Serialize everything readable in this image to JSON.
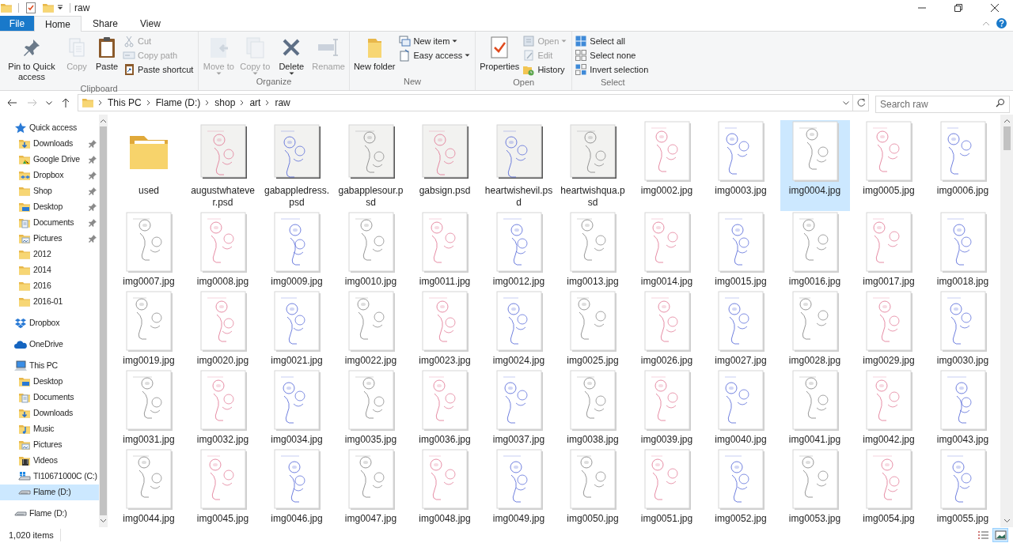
{
  "window": {
    "title": "raw"
  },
  "ribbon_tabs": [
    {
      "label": "File",
      "kind": "file",
      "selected": false
    },
    {
      "label": "Home",
      "kind": "tab",
      "selected": true
    },
    {
      "label": "Share",
      "kind": "tab",
      "selected": false
    },
    {
      "label": "View",
      "kind": "tab",
      "selected": false
    }
  ],
  "ribbon_groups": [
    {
      "label": "Clipboard",
      "items": [
        {
          "kind": "large",
          "label": "Pin to Quick access",
          "disabled": false
        },
        {
          "kind": "large",
          "label": "Copy",
          "disabled": true
        },
        {
          "kind": "large",
          "label": "Paste",
          "disabled": false
        },
        {
          "kind": "stack",
          "items": [
            {
              "label": "Cut",
              "disabled": true
            },
            {
              "label": "Copy path",
              "disabled": true
            },
            {
              "label": "Paste shortcut",
              "disabled": false
            }
          ]
        }
      ]
    },
    {
      "label": "Organize",
      "items": [
        {
          "kind": "large",
          "label": "Move to",
          "disabled": true,
          "dropdown": true
        },
        {
          "kind": "large",
          "label": "Copy to",
          "disabled": true,
          "dropdown": true
        },
        {
          "kind": "large",
          "label": "Delete",
          "disabled": false,
          "dropdown": true
        },
        {
          "kind": "large",
          "label": "Rename",
          "disabled": true
        }
      ]
    },
    {
      "label": "New",
      "items": [
        {
          "kind": "large",
          "label": "New folder",
          "disabled": false
        },
        {
          "kind": "stack",
          "items": [
            {
              "label": "New item",
              "disabled": false,
              "dropdown": true
            },
            {
              "label": "Easy access",
              "disabled": false,
              "dropdown": true
            }
          ]
        }
      ]
    },
    {
      "label": "Open",
      "items": [
        {
          "kind": "large",
          "label": "Properties",
          "disabled": false
        },
        {
          "kind": "stack",
          "items": [
            {
              "label": "Open",
              "disabled": true,
              "dropdown": true
            },
            {
              "label": "Edit",
              "disabled": true
            },
            {
              "label": "History",
              "disabled": false
            }
          ]
        }
      ]
    },
    {
      "label": "Select",
      "items": [
        {
          "kind": "stack",
          "items": [
            {
              "label": "Select all",
              "disabled": false
            },
            {
              "label": "Select none",
              "disabled": false
            },
            {
              "label": "Invert selection",
              "disabled": false
            }
          ]
        }
      ]
    }
  ],
  "address_bar": {
    "path": [
      "This PC",
      "Flame (D:)",
      "shop",
      "art",
      "raw"
    ]
  },
  "search": {
    "placeholder": "Search raw"
  },
  "navigation": [
    {
      "label": "Quick access",
      "kind": "star",
      "selected": false,
      "children": [
        {
          "label": "Downloads",
          "kind": "downloads",
          "pinned": true,
          "selected": false
        },
        {
          "label": "Google Drive",
          "kind": "gdrive",
          "pinned": true,
          "selected": false
        },
        {
          "label": "Dropbox",
          "kind": "dropboxfolder",
          "pinned": true,
          "selected": false
        },
        {
          "label": "Shop",
          "kind": "folder",
          "pinned": true,
          "selected": false
        },
        {
          "label": "Desktop",
          "kind": "desktop",
          "pinned": true,
          "selected": false
        },
        {
          "label": "Documents",
          "kind": "documents",
          "pinned": true,
          "selected": false
        },
        {
          "label": "Pictures",
          "kind": "pictures",
          "pinned": true,
          "selected": false
        },
        {
          "label": "2012",
          "kind": "folder",
          "pinned": false,
          "selected": false
        },
        {
          "label": "2014",
          "kind": "folder",
          "pinned": false,
          "selected": false
        },
        {
          "label": "2016",
          "kind": "folder",
          "pinned": false,
          "selected": false
        },
        {
          "label": "2016-01",
          "kind": "folder",
          "pinned": false,
          "selected": false
        }
      ]
    },
    {
      "label": "Dropbox",
      "kind": "dropbox",
      "selected": false
    },
    {
      "label": "OneDrive",
      "kind": "onedrive",
      "selected": false
    },
    {
      "label": "This PC",
      "kind": "pc",
      "selected": false,
      "children": [
        {
          "label": "Desktop",
          "kind": "desktop",
          "selected": false
        },
        {
          "label": "Documents",
          "kind": "documents",
          "selected": false
        },
        {
          "label": "Downloads",
          "kind": "downloads",
          "selected": false
        },
        {
          "label": "Music",
          "kind": "music",
          "selected": false
        },
        {
          "label": "Pictures",
          "kind": "pictures",
          "selected": false
        },
        {
          "label": "Videos",
          "kind": "videos",
          "selected": false
        },
        {
          "label": "TI10671000C (C:)",
          "kind": "windrive",
          "selected": false
        },
        {
          "label": "Flame (D:)",
          "kind": "drive",
          "selected": true
        }
      ]
    },
    {
      "label": "Flame (D:)",
      "kind": "drive",
      "selected": false
    }
  ],
  "files": [
    {
      "name": "used",
      "kind": "folder",
      "selected": false
    },
    {
      "name": "augustwhatever.psd",
      "selected": false
    },
    {
      "name": "gabappledress.psd",
      "selected": false
    },
    {
      "name": "gabapplesour.psd",
      "selected": false
    },
    {
      "name": "gabsign.psd",
      "selected": false
    },
    {
      "name": "heartwishevil.psd",
      "selected": false
    },
    {
      "name": "heartwishqua.psd",
      "selected": false
    },
    {
      "name": "img0002.jpg",
      "selected": false
    },
    {
      "name": "img0003.jpg",
      "selected": false
    },
    {
      "name": "img0004.jpg",
      "selected": true
    },
    {
      "name": "img0005.jpg",
      "selected": false
    },
    {
      "name": "img0006.jpg",
      "selected": false
    },
    {
      "name": "img0007.jpg",
      "selected": false
    },
    {
      "name": "img0008.jpg",
      "selected": false
    },
    {
      "name": "img0009.jpg",
      "selected": false
    },
    {
      "name": "img0010.jpg",
      "selected": false
    },
    {
      "name": "img0011.jpg",
      "selected": false
    },
    {
      "name": "img0012.jpg",
      "selected": false
    },
    {
      "name": "img0013.jpg",
      "selected": false
    },
    {
      "name": "img0014.jpg",
      "selected": false
    },
    {
      "name": "img0015.jpg",
      "selected": false
    },
    {
      "name": "img0016.jpg",
      "selected": false
    },
    {
      "name": "img0017.jpg",
      "selected": false
    },
    {
      "name": "img0018.jpg",
      "selected": false
    },
    {
      "name": "img0019.jpg",
      "selected": false
    },
    {
      "name": "img0020.jpg",
      "selected": false
    },
    {
      "name": "img0021.jpg",
      "selected": false
    },
    {
      "name": "img0022.jpg",
      "selected": false
    },
    {
      "name": "img0023.jpg",
      "selected": false
    },
    {
      "name": "img0024.jpg",
      "selected": false
    },
    {
      "name": "img0025.jpg",
      "selected": false
    },
    {
      "name": "img0026.jpg",
      "selected": false
    },
    {
      "name": "img0027.jpg",
      "selected": false
    },
    {
      "name": "img0028.jpg",
      "selected": false
    },
    {
      "name": "img0029.jpg",
      "selected": false
    },
    {
      "name": "img0030.jpg",
      "selected": false
    },
    {
      "name": "img0031.jpg",
      "selected": false
    },
    {
      "name": "img0032.jpg",
      "selected": false
    },
    {
      "name": "img0034.jpg",
      "selected": false
    },
    {
      "name": "img0035.jpg",
      "selected": false
    },
    {
      "name": "img0036.jpg",
      "selected": false
    },
    {
      "name": "img0037.jpg",
      "selected": false
    },
    {
      "name": "img0038.jpg",
      "selected": false
    },
    {
      "name": "img0039.jpg",
      "selected": false
    },
    {
      "name": "img0040.jpg",
      "selected": false
    },
    {
      "name": "img0041.jpg",
      "selected": false
    },
    {
      "name": "img0042.jpg",
      "selected": false
    },
    {
      "name": "img0043.jpg",
      "selected": false
    },
    {
      "name": "img0044.jpg",
      "selected": false
    },
    {
      "name": "img0045.jpg",
      "selected": false
    },
    {
      "name": "img0046.jpg",
      "selected": false
    },
    {
      "name": "img0047.jpg",
      "selected": false
    },
    {
      "name": "img0048.jpg",
      "selected": false
    },
    {
      "name": "img0049.jpg",
      "selected": false
    },
    {
      "name": "img0050.jpg",
      "selected": false
    },
    {
      "name": "img0051.jpg",
      "selected": false
    },
    {
      "name": "img0052.jpg",
      "selected": false
    },
    {
      "name": "img0053.jpg",
      "selected": false
    },
    {
      "name": "img0054.jpg",
      "selected": false
    },
    {
      "name": "img0055.jpg",
      "selected": false
    }
  ],
  "status_bar": {
    "item_count": "1,020 items",
    "views": [
      {
        "kind": "details",
        "selected": false
      },
      {
        "kind": "large_icons",
        "selected": true
      }
    ]
  }
}
